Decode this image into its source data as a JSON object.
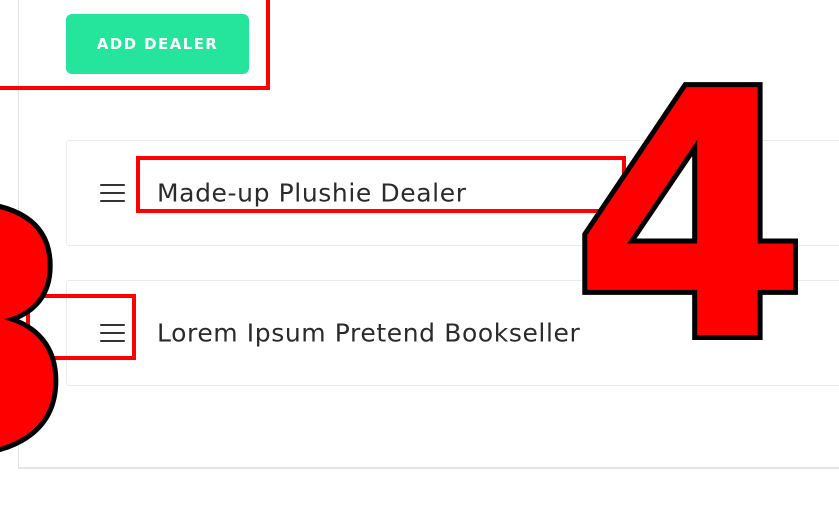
{
  "toolbar": {
    "add_dealer_label": "ADD DEALER"
  },
  "dealers": [
    {
      "name": "Made-up Plushie Dealer",
      "handle_icon": "hamburger-icon"
    },
    {
      "name": "Lorem Ipsum Pretend Bookseller",
      "handle_icon": "hamburger-icon"
    }
  ],
  "annotations": {
    "callout_4": "4",
    "callout_3": "3",
    "color": "#ff0000"
  },
  "colors": {
    "button": "#25e49b",
    "text": "#2b2b2b",
    "border": "#ebebeb"
  }
}
